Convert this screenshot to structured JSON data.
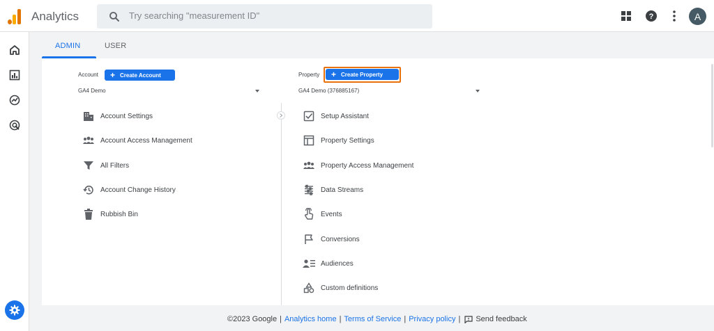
{
  "app": {
    "title": "Analytics",
    "avatar_letter": "A"
  },
  "search": {
    "placeholder": "Try searching \"measurement ID\""
  },
  "topbar_icons": [
    "apps-grid-icon",
    "help-icon",
    "more-vert-icon"
  ],
  "rail": {
    "items": [
      "home-icon",
      "reports-icon",
      "explore-icon",
      "advertising-icon"
    ],
    "bottom": "admin-gear-icon"
  },
  "tabs": [
    {
      "label": "ADMIN",
      "active": true
    },
    {
      "label": "USER",
      "active": false
    }
  ],
  "account": {
    "label": "Account",
    "create_label": "Create Account",
    "selected": "GA4 Demo",
    "items": [
      {
        "label": "Account Settings",
        "icon": "building-icon"
      },
      {
        "label": "Account Access Management",
        "icon": "people-icon"
      },
      {
        "label": "All Filters",
        "icon": "filter-icon"
      },
      {
        "label": "Account Change History",
        "icon": "history-icon"
      },
      {
        "label": "Rubbish Bin",
        "icon": "trash-icon"
      }
    ]
  },
  "property": {
    "label": "Property",
    "create_label": "Create Property",
    "selected": "GA4 Demo (376885167)",
    "items": [
      {
        "label": "Setup Assistant",
        "icon": "checklist-icon"
      },
      {
        "label": "Property Settings",
        "icon": "settings-panel-icon"
      },
      {
        "label": "Property Access Management",
        "icon": "people-icon"
      },
      {
        "label": "Data Streams",
        "icon": "streams-icon"
      },
      {
        "label": "Events",
        "icon": "touch-icon"
      },
      {
        "label": "Conversions",
        "icon": "flag-icon"
      },
      {
        "label": "Audiences",
        "icon": "audience-icon"
      },
      {
        "label": "Custom definitions",
        "icon": "shapes-icon"
      }
    ]
  },
  "footer": {
    "copyright": "©2023 Google",
    "links": [
      "Analytics home",
      "Terms of Service",
      "Privacy policy"
    ],
    "feedback": "Send feedback"
  },
  "colors": {
    "accent": "#1a73e8",
    "highlight": "#e8710a",
    "logo_orange": "#e37400",
    "logo_yellow": "#f9ab00"
  }
}
